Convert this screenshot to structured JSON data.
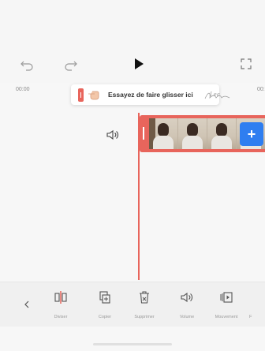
{
  "player": {
    "undo_icon": "undo-icon",
    "redo_icon": "redo-icon",
    "play_icon": "play-icon",
    "fullscreen_icon": "fullscreen-icon"
  },
  "timeline": {
    "time_start": "00:00",
    "time_end": "00:"
  },
  "tooltip": {
    "text": "Essayez de faire glisser ici",
    "handwriting": "Lea"
  },
  "clip": {
    "add_label": "+"
  },
  "toolbar": {
    "back_icon": "chevron-left-icon",
    "items": [
      {
        "label": "Diviser",
        "icon": "split-icon"
      },
      {
        "label": "Copier",
        "icon": "copy-icon"
      },
      {
        "label": "Supprimer",
        "icon": "trash-icon"
      },
      {
        "label": "Volume",
        "icon": "volume-icon"
      },
      {
        "label": "Mouvement",
        "icon": "motion-icon"
      },
      {
        "label": "F",
        "icon": "more-icon"
      }
    ]
  },
  "colors": {
    "accent": "#e8655c",
    "add_button": "#2f7ef0"
  }
}
